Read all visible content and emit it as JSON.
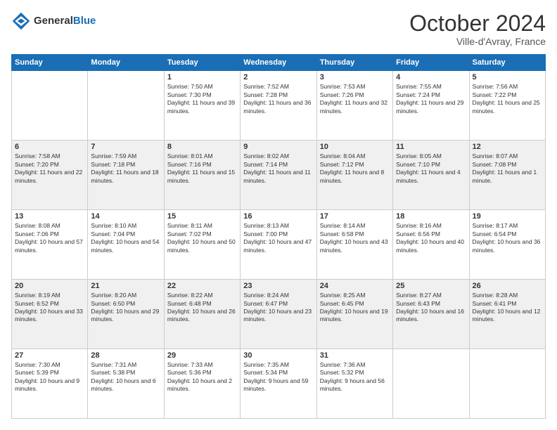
{
  "header": {
    "logo_general": "General",
    "logo_blue": "Blue",
    "month_title": "October 2024",
    "location": "Ville-d'Avray, France"
  },
  "weekdays": [
    "Sunday",
    "Monday",
    "Tuesday",
    "Wednesday",
    "Thursday",
    "Friday",
    "Saturday"
  ],
  "weeks": [
    [
      {
        "day": "",
        "info": ""
      },
      {
        "day": "",
        "info": ""
      },
      {
        "day": "1",
        "info": "Sunrise: 7:50 AM\nSunset: 7:30 PM\nDaylight: 11 hours and 39 minutes."
      },
      {
        "day": "2",
        "info": "Sunrise: 7:52 AM\nSunset: 7:28 PM\nDaylight: 11 hours and 36 minutes."
      },
      {
        "day": "3",
        "info": "Sunrise: 7:53 AM\nSunset: 7:26 PM\nDaylight: 11 hours and 32 minutes."
      },
      {
        "day": "4",
        "info": "Sunrise: 7:55 AM\nSunset: 7:24 PM\nDaylight: 11 hours and 29 minutes."
      },
      {
        "day": "5",
        "info": "Sunrise: 7:56 AM\nSunset: 7:22 PM\nDaylight: 11 hours and 25 minutes."
      }
    ],
    [
      {
        "day": "6",
        "info": "Sunrise: 7:58 AM\nSunset: 7:20 PM\nDaylight: 11 hours and 22 minutes."
      },
      {
        "day": "7",
        "info": "Sunrise: 7:59 AM\nSunset: 7:18 PM\nDaylight: 11 hours and 18 minutes."
      },
      {
        "day": "8",
        "info": "Sunrise: 8:01 AM\nSunset: 7:16 PM\nDaylight: 11 hours and 15 minutes."
      },
      {
        "day": "9",
        "info": "Sunrise: 8:02 AM\nSunset: 7:14 PM\nDaylight: 11 hours and 11 minutes."
      },
      {
        "day": "10",
        "info": "Sunrise: 8:04 AM\nSunset: 7:12 PM\nDaylight: 11 hours and 8 minutes."
      },
      {
        "day": "11",
        "info": "Sunrise: 8:05 AM\nSunset: 7:10 PM\nDaylight: 11 hours and 4 minutes."
      },
      {
        "day": "12",
        "info": "Sunrise: 8:07 AM\nSunset: 7:08 PM\nDaylight: 11 hours and 1 minute."
      }
    ],
    [
      {
        "day": "13",
        "info": "Sunrise: 8:08 AM\nSunset: 7:06 PM\nDaylight: 10 hours and 57 minutes."
      },
      {
        "day": "14",
        "info": "Sunrise: 8:10 AM\nSunset: 7:04 PM\nDaylight: 10 hours and 54 minutes."
      },
      {
        "day": "15",
        "info": "Sunrise: 8:11 AM\nSunset: 7:02 PM\nDaylight: 10 hours and 50 minutes."
      },
      {
        "day": "16",
        "info": "Sunrise: 8:13 AM\nSunset: 7:00 PM\nDaylight: 10 hours and 47 minutes."
      },
      {
        "day": "17",
        "info": "Sunrise: 8:14 AM\nSunset: 6:58 PM\nDaylight: 10 hours and 43 minutes."
      },
      {
        "day": "18",
        "info": "Sunrise: 8:16 AM\nSunset: 6:56 PM\nDaylight: 10 hours and 40 minutes."
      },
      {
        "day": "19",
        "info": "Sunrise: 8:17 AM\nSunset: 6:54 PM\nDaylight: 10 hours and 36 minutes."
      }
    ],
    [
      {
        "day": "20",
        "info": "Sunrise: 8:19 AM\nSunset: 6:52 PM\nDaylight: 10 hours and 33 minutes."
      },
      {
        "day": "21",
        "info": "Sunrise: 8:20 AM\nSunset: 6:50 PM\nDaylight: 10 hours and 29 minutes."
      },
      {
        "day": "22",
        "info": "Sunrise: 8:22 AM\nSunset: 6:48 PM\nDaylight: 10 hours and 26 minutes."
      },
      {
        "day": "23",
        "info": "Sunrise: 8:24 AM\nSunset: 6:47 PM\nDaylight: 10 hours and 23 minutes."
      },
      {
        "day": "24",
        "info": "Sunrise: 8:25 AM\nSunset: 6:45 PM\nDaylight: 10 hours and 19 minutes."
      },
      {
        "day": "25",
        "info": "Sunrise: 8:27 AM\nSunset: 6:43 PM\nDaylight: 10 hours and 16 minutes."
      },
      {
        "day": "26",
        "info": "Sunrise: 8:28 AM\nSunset: 6:41 PM\nDaylight: 10 hours and 12 minutes."
      }
    ],
    [
      {
        "day": "27",
        "info": "Sunrise: 7:30 AM\nSunset: 5:39 PM\nDaylight: 10 hours and 9 minutes."
      },
      {
        "day": "28",
        "info": "Sunrise: 7:31 AM\nSunset: 5:38 PM\nDaylight: 10 hours and 6 minutes."
      },
      {
        "day": "29",
        "info": "Sunrise: 7:33 AM\nSunset: 5:36 PM\nDaylight: 10 hours and 2 minutes."
      },
      {
        "day": "30",
        "info": "Sunrise: 7:35 AM\nSunset: 5:34 PM\nDaylight: 9 hours and 59 minutes."
      },
      {
        "day": "31",
        "info": "Sunrise: 7:36 AM\nSunset: 5:32 PM\nDaylight: 9 hours and 56 minutes."
      },
      {
        "day": "",
        "info": ""
      },
      {
        "day": "",
        "info": ""
      }
    ]
  ]
}
